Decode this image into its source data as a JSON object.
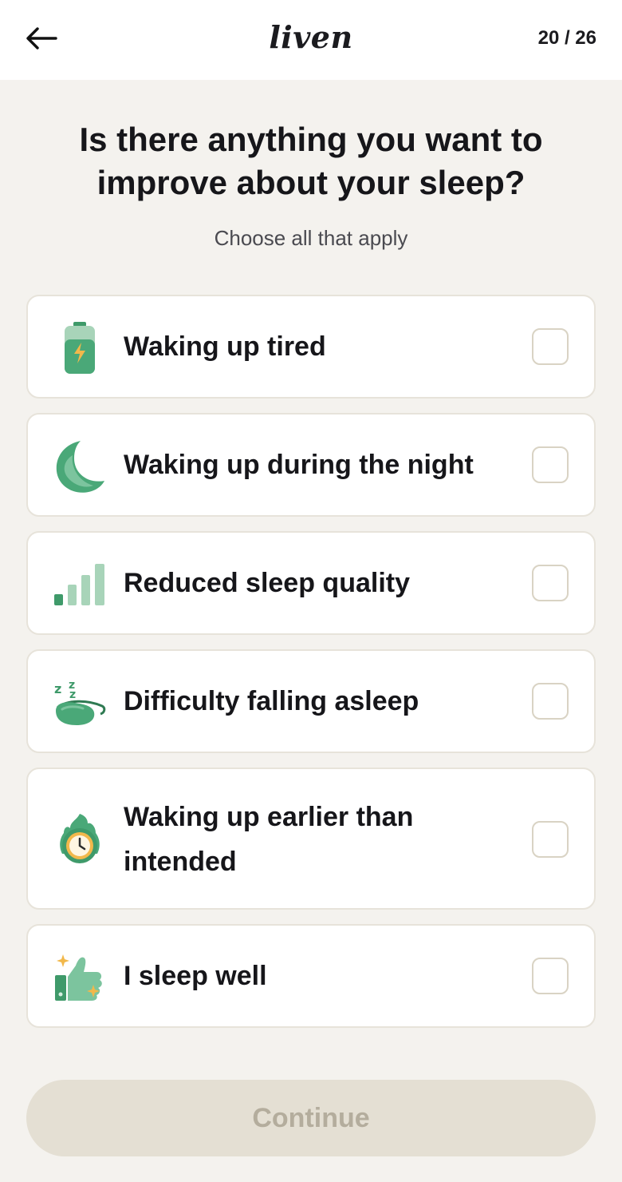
{
  "header": {
    "logo": "liven",
    "progress": "20 / 26"
  },
  "question": {
    "title": "Is there anything you want to improve about your sleep?",
    "subtitle": "Choose all that apply"
  },
  "options": [
    {
      "label": "Waking up tired",
      "icon": "battery-icon",
      "checked": false
    },
    {
      "label": "Waking up during the night",
      "icon": "moon-icon",
      "checked": false
    },
    {
      "label": "Reduced sleep quality",
      "icon": "signal-bars-icon",
      "checked": false
    },
    {
      "label": "Difficulty falling asleep",
      "icon": "sleep-mask-icon",
      "checked": false
    },
    {
      "label": "Waking up earlier than intended",
      "icon": "burning-clock-icon",
      "checked": false
    },
    {
      "label": "I sleep well",
      "icon": "thumbs-up-icon",
      "checked": false
    }
  ],
  "continue_label": "Continue",
  "colors": {
    "background": "#f4f2ee",
    "accent_green": "#4aa878",
    "disabled_button": "#e4dfd3",
    "disabled_text": "#b4ad9d"
  }
}
